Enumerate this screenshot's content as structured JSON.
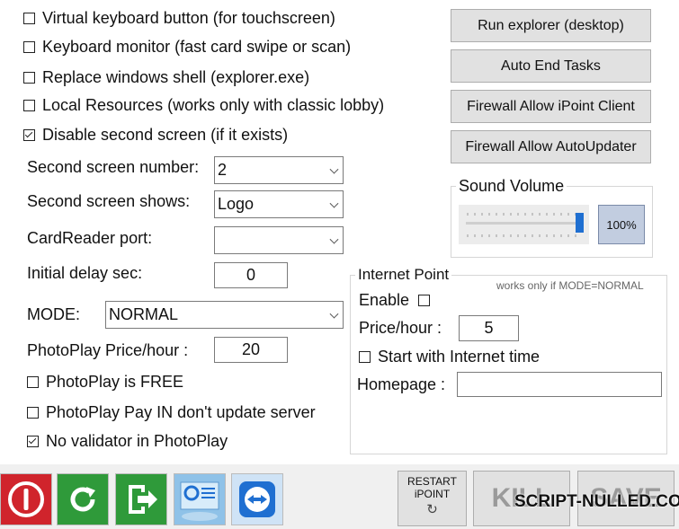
{
  "options": {
    "virtual_keyboard": {
      "label": "Virtual keyboard button (for touchscreen)",
      "checked": false
    },
    "keyboard_monitor": {
      "label": "Keyboard monitor (fast card swipe or scan)",
      "checked": false
    },
    "replace_shell": {
      "label": "Replace windows shell (explorer.exe)",
      "checked": false
    },
    "local_resources": {
      "label": "Local Resources (works only with classic lobby)",
      "checked": false
    },
    "disable_second_screen": {
      "label": "Disable second screen (if it exists)",
      "checked": true
    }
  },
  "fields": {
    "second_screen_number": {
      "label": "Second screen number:",
      "value": "2"
    },
    "second_screen_shows": {
      "label": "Second screen shows:",
      "value": "Logo"
    },
    "cardreader_port": {
      "label": "CardReader port:",
      "value": ""
    },
    "initial_delay": {
      "label": "Initial delay sec:",
      "value": "0"
    },
    "mode": {
      "label": "MODE:",
      "value": "NORMAL"
    },
    "photoplay_price": {
      "label": "PhotoPlay Price/hour :",
      "value": "20"
    }
  },
  "photoplay": {
    "free": {
      "label": "PhotoPlay is FREE",
      "checked": false
    },
    "pay_in": {
      "label": "PhotoPlay Pay IN don't update server",
      "checked": false
    },
    "no_validator": {
      "label": "No validator in PhotoPlay",
      "checked": true
    }
  },
  "buttons": {
    "run_explorer": "Run explorer (desktop)",
    "auto_end_tasks": "Auto End Tasks",
    "firewall_ipoint": "Firewall Allow iPoint Client",
    "firewall_updater": "Firewall Allow AutoUpdater"
  },
  "sound": {
    "title": "Sound Volume",
    "value_text": "100%",
    "level": 1.0
  },
  "internet_point": {
    "title": "Internet Point",
    "note": "works only if MODE=NORMAL",
    "enable_label": "Enable",
    "enable_checked": false,
    "price_label": "Price/hour :",
    "price_value": "5",
    "start_label": "Start with Internet time",
    "start_checked": false,
    "homepage_label": "Homepage :",
    "homepage_value": ""
  },
  "toolbar": {
    "restart_label_line1": "RESTART",
    "restart_label_line2": "iPOINT",
    "kill_label": "KILL",
    "save_label": "SAVE",
    "watermark": "SCRIPT-NULLED.CO"
  },
  "colors": {
    "power_red": "#d0242c",
    "refresh_green": "#2f9a3a",
    "exit_green": "#2f9a3a",
    "teamviewer_blue": "#1f6fd1"
  }
}
